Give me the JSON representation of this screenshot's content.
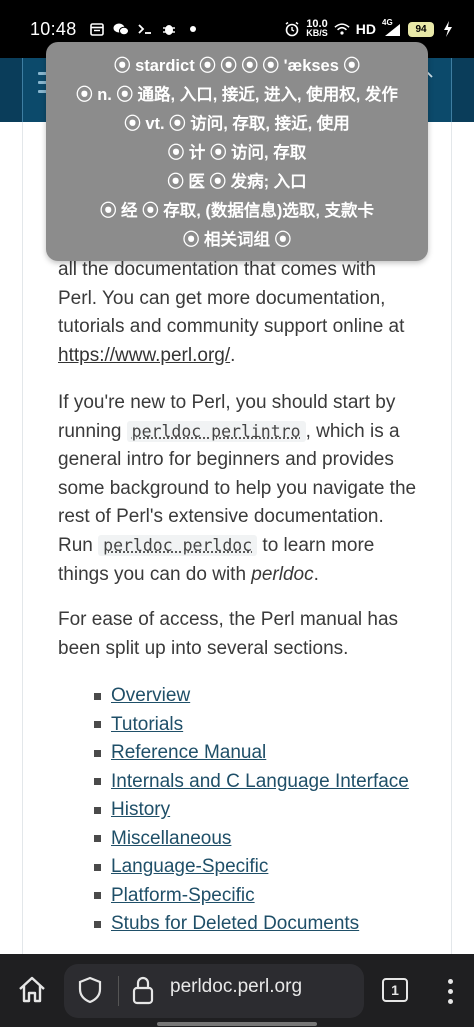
{
  "status_bar": {
    "time": "10:48",
    "net_speed_value": "10.0",
    "net_speed_unit": "KB/S",
    "hd_label": "HD",
    "signal_label": "4G",
    "battery_level": "94"
  },
  "dictionary_popup": {
    "lines": [
      "⦿ stardict ⦿ ⦿  ⦿ ⦿ 'ækses ⦿",
      "⦿ n. ⦿ 通路, 入口, 接近, 进入, 使用权, 发作",
      "⦿ vt. ⦿ 访问, 存取, 接近, 使用",
      "⦿ 计 ⦿ 访问, 存取",
      "⦿ 医 ⦿ 发病; 入口",
      "⦿ 经 ⦿ 存取, (数据信息)选取, 支款卡",
      "⦿ 相关词组 ⦿"
    ]
  },
  "content": {
    "para1_text": "all the documentation that comes with Perl. You can get more documentation, tutorials and community support online at ",
    "para1_link": "https://www.perl.org/",
    "para1_end": ".",
    "para2_start": "If you're new to Perl, you should start by running ",
    "para2_code1": "perldoc perlintro",
    "para2_mid": ", which is a general intro for beginners and provides some background to help you navigate the rest of Perl's extensive documentation. Run ",
    "para2_code2": "perldoc perldoc",
    "para2_mid2": " to learn more things you can do with ",
    "para2_em": "perldoc",
    "para2_end": ".",
    "para3_text": "For ease of access, the Perl manual has been split up into several sections.",
    "sections": [
      "Overview",
      "Tutorials",
      "Reference Manual",
      "Internals and C Language Interface",
      "History",
      "Miscellaneous",
      "Language-Specific",
      "Platform-Specific",
      "Stubs for Deleted Documents"
    ]
  },
  "browser": {
    "url": "perldoc.perl.org",
    "tab_count": "1"
  }
}
